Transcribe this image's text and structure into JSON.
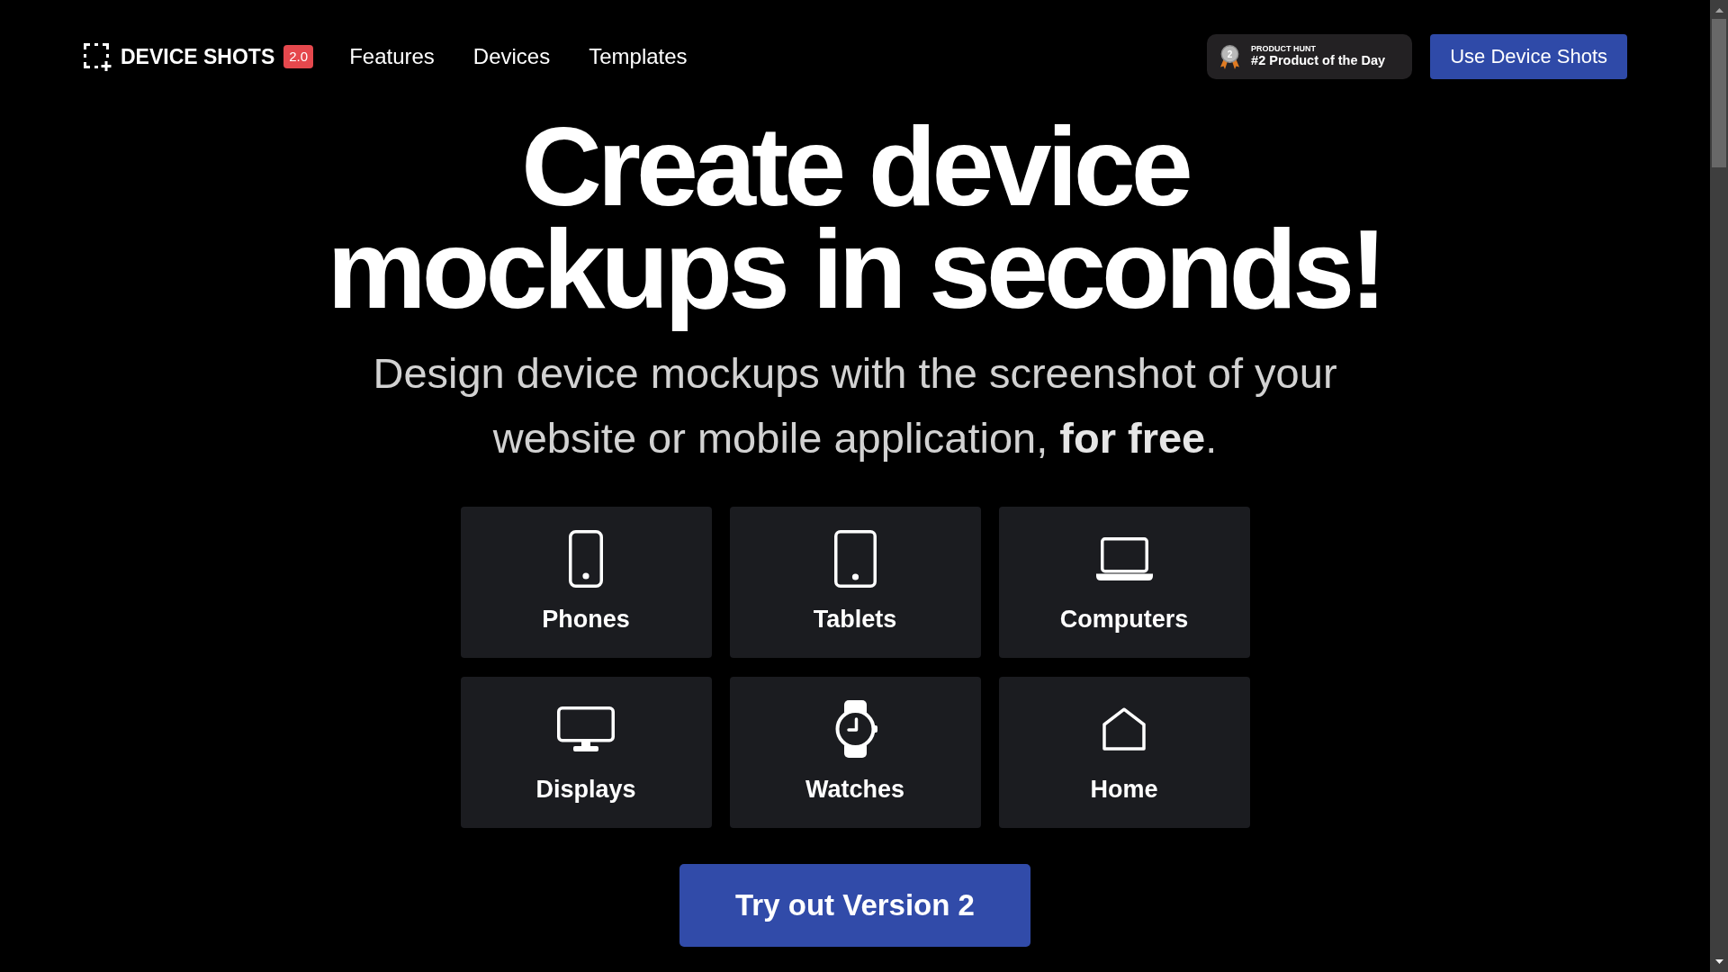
{
  "header": {
    "brand": "DEVICE SHOTS",
    "version_badge": "2.0",
    "nav": [
      "Features",
      "Devices",
      "Templates"
    ],
    "award": {
      "medal_rank": "2",
      "overline": "PRODUCT HUNT",
      "title": "#2 Product of the Day"
    },
    "cta": "Use Device Shots"
  },
  "hero": {
    "title": "Create device mockups in seconds!",
    "subtitle": "Design device mockups with the screenshot of your website or mobile application, **for free**."
  },
  "device_categories": [
    {
      "kind": "phone",
      "label": "Phones"
    },
    {
      "kind": "tablet",
      "label": "Tablets"
    },
    {
      "kind": "laptop",
      "label": "Computers"
    },
    {
      "kind": "monitor",
      "label": "Displays"
    },
    {
      "kind": "watch",
      "label": "Watches"
    },
    {
      "kind": "home",
      "label": "Home"
    }
  ],
  "cta_button": "Try out Version 2"
}
